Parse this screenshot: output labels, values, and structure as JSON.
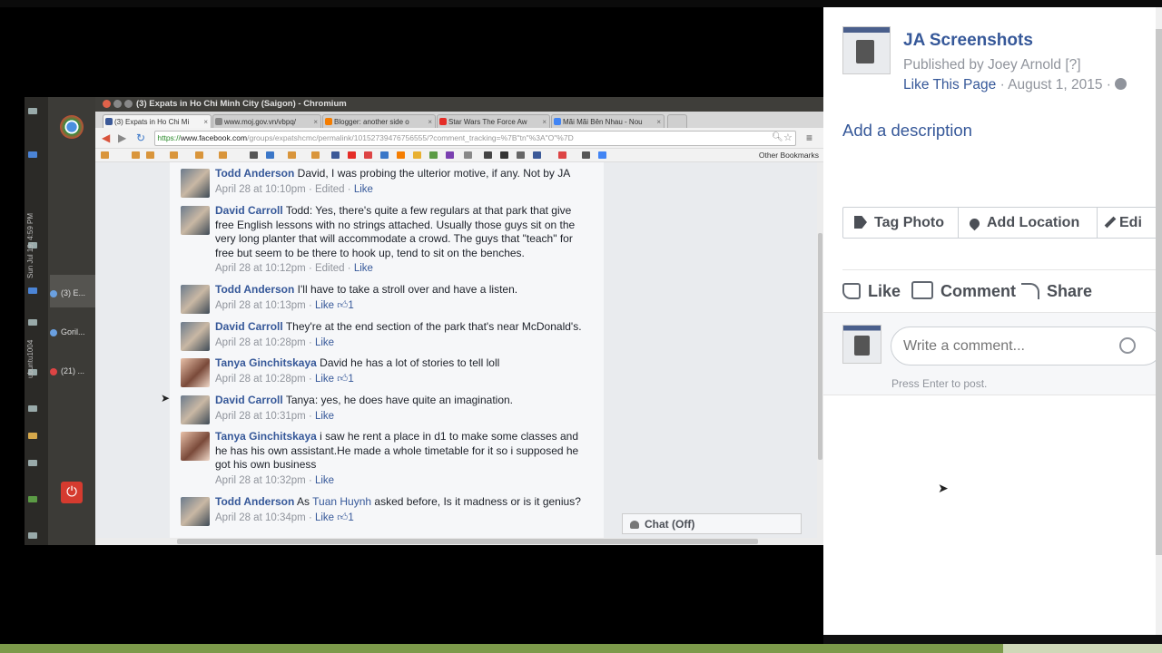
{
  "screenshot": {
    "window_title": "(3) Expats in Ho Chi Minh City (Saigon) - Chromium",
    "tabs": [
      {
        "label": "(3) Expats in Ho Chi Mi",
        "color": "#3b5998",
        "active": true
      },
      {
        "label": "www.moj.gov.vn/vbpq/",
        "color": "#888888",
        "active": false
      },
      {
        "label": "Blogger: another side o",
        "color": "#f57d00",
        "active": false
      },
      {
        "label": "Star Wars The Force Aw",
        "color": "#e52d27",
        "active": false
      },
      {
        "label": "Mãi Mãi Bên Nhau - Nou",
        "color": "#4285f4",
        "active": false
      }
    ],
    "url": {
      "https": "https://",
      "host": "www.facebook.com",
      "path": "/groups/expatshcmc/permalink/10152739476756555/?comment_tracking=%7B\"tn\"%3A\"O\"%7D"
    },
    "other_bookmarks": "Other Bookmarks",
    "launcher": {
      "date_text": "Sun Jul 19, 4:59 PM",
      "host_text": "ubuntu1004",
      "items": [
        "(3) E...",
        "Goril...",
        "(21) ..."
      ]
    },
    "comments": [
      {
        "name": "Todd Anderson",
        "text": "David, I was probing the ulterior motive, if any. Not by JA",
        "time": "April 28 at 10:10pm",
        "edited": "· Edited ·",
        "like": "Like",
        "count": ""
      },
      {
        "name": "David Carroll",
        "text": "Todd: Yes, there's quite a few regulars at that park that give free English lessons with no strings attached. Usually those guys sit on the very long planter that will accommodate a crowd. The guys that \"teach\" for free but seem to be there to hook up, tend to sit on the benches.",
        "time": "April 28 at 10:12pm",
        "edited": "· Edited ·",
        "like": "Like",
        "count": ""
      },
      {
        "name": "Todd Anderson",
        "text": "I'll have to take a stroll over and have a listen.",
        "time": "April 28 at 10:13pm",
        "edited": "·",
        "like": "Like",
        "count": "1"
      },
      {
        "name": "David Carroll",
        "text": "They're at the end section of the park that's near McDonald's.",
        "time": "April 28 at 10:28pm",
        "edited": "·",
        "like": "Like",
        "count": ""
      },
      {
        "name": "Tanya Ginchitskaya",
        "text": "David he has a lot of stories to tell loll",
        "time": "April 28 at 10:28pm",
        "edited": "·",
        "like": "Like",
        "count": "1"
      },
      {
        "name": "David Carroll",
        "text": "Tanya: yes, he does have quite an imagination.",
        "time": "April 28 at 10:31pm",
        "edited": "·",
        "like": "Like",
        "count": ""
      },
      {
        "name": "Tanya Ginchitskaya",
        "text": "i saw he rent a place in d1 to make some classes and he has his own assistant.He made a whole timetable for it so i supposed he got his own business",
        "time": "April 28 at 10:32pm",
        "edited": "·",
        "like": "Like",
        "count": ""
      },
      {
        "name": "Todd Anderson",
        "text_before": "As",
        "tag": "Tuan Huynh",
        "text": "asked before, Is it madness or is it genius?",
        "time": "April 28 at 10:34pm",
        "edited": "·",
        "like": "Like",
        "count": "1"
      }
    ],
    "chat_label": "Chat (Off)"
  },
  "panel": {
    "page_title": "JA Screenshots",
    "published": "Published by Joey Arnold [?]",
    "like_page": "Like This Page",
    "date": "· August 1, 2015 ·",
    "add_description": "Add a description",
    "actions": [
      "Tag Photo",
      "Add Location",
      "Edi"
    ],
    "ufi": {
      "like": "Like",
      "comment": "Comment",
      "share": "Share"
    },
    "comment_placeholder": "Write a comment...",
    "press_enter": "Press Enter to post."
  }
}
